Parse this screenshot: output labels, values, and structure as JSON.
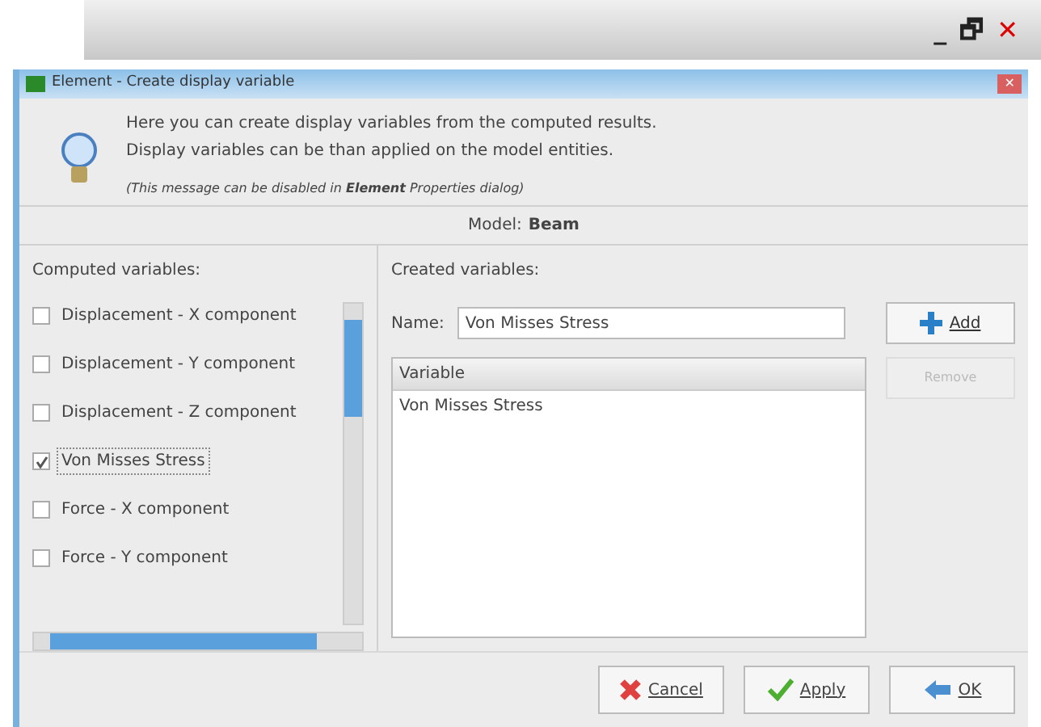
{
  "outer_window": {
    "controls": [
      "_",
      "🗗",
      "✕"
    ]
  },
  "dialog": {
    "title": "Element - Create display variable",
    "close": "✕"
  },
  "info": {
    "lines": [
      "Here you can create display variables from the computed results.",
      "Display variables can be than applied on the model entities."
    ],
    "note": "(This message can be disabled in **Element** Properties dialog)"
  },
  "model": {
    "label": "Model:",
    "value": "Beam"
  },
  "computed": {
    "heading": "Computed variables:",
    "items": [
      {
        "label": "Displacement - X component",
        "checked": false,
        "selected": false
      },
      {
        "label": "Displacement - Y component",
        "checked": false,
        "selected": false
      },
      {
        "label": "Displacement - Z component",
        "checked": false,
        "selected": false
      },
      {
        "label": "Von Misses Stress",
        "checked": true,
        "selected": true
      },
      {
        "label": "Force - X component",
        "checked": false,
        "selected": false
      },
      {
        "label": "Force - Y component",
        "checked": false,
        "selected": false
      }
    ]
  },
  "created": {
    "heading": "Created variables:",
    "name_label": "Name:",
    "name_value": "Von Misses Stress",
    "add": {
      "label": "Add",
      "disabled": false
    },
    "remove": {
      "label": "Remove",
      "disabled": true
    },
    "column": "Variable",
    "rows": [
      "Von Misses Stress"
    ]
  },
  "buttons": [
    {
      "kind": "cancel",
      "label": "Cancel"
    },
    {
      "kind": "apply",
      "label": "Apply"
    },
    {
      "kind": "ok",
      "label": "OK"
    }
  ]
}
